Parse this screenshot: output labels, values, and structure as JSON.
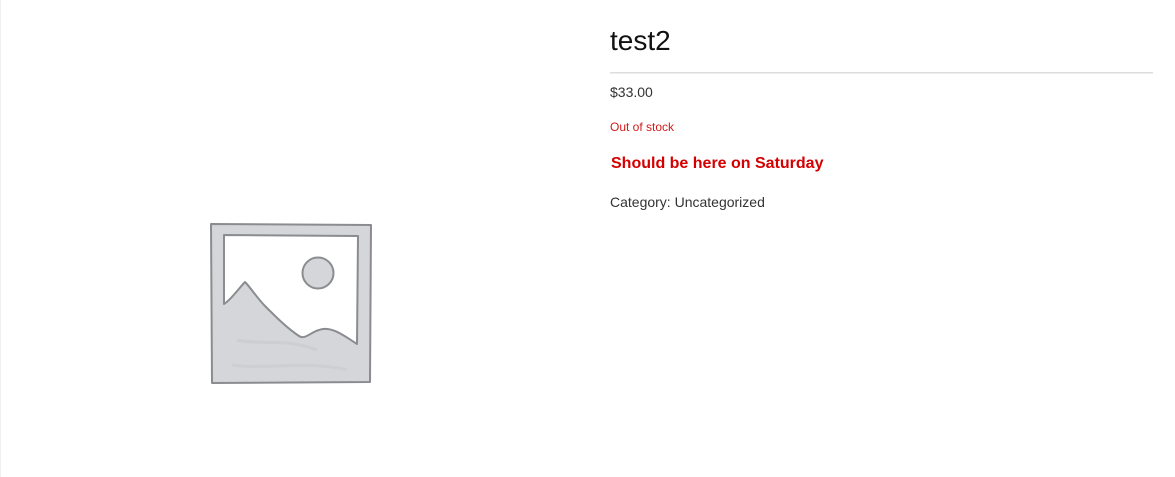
{
  "product": {
    "title": "test2",
    "price": "$33.00",
    "stock_status": "Out of stock",
    "availability_notice": "Should be here on Saturday",
    "category_label": "Category:",
    "category_value": "Uncategorized"
  },
  "gallery": {
    "image_icon": "image-placeholder-icon"
  },
  "colors": {
    "stock_status": "#d01b1b",
    "notice": "#d40000",
    "placeholder_fill": "#d4d6da",
    "placeholder_stroke": "#8a8c90"
  }
}
